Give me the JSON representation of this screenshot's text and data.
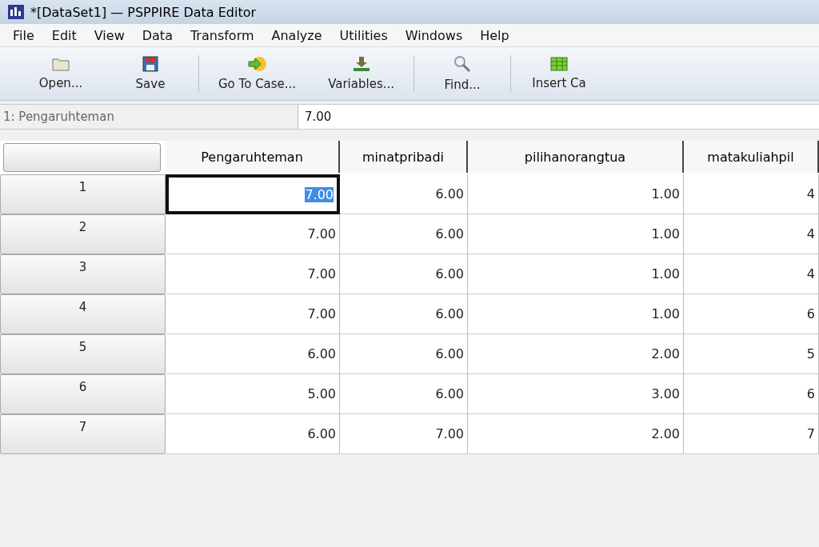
{
  "window": {
    "title": "*[DataSet1] — PSPPIRE Data Editor"
  },
  "menu": [
    "File",
    "Edit",
    "View",
    "Data",
    "Transform",
    "Analyze",
    "Utilities",
    "Windows",
    "Help"
  ],
  "toolbar": [
    {
      "kind": "open",
      "label": "Open..."
    },
    {
      "kind": "save",
      "label": "Save"
    },
    {
      "kind": "sep"
    },
    {
      "kind": "goto",
      "label": "Go To Case..."
    },
    {
      "kind": "variables",
      "label": "Variables..."
    },
    {
      "kind": "sep"
    },
    {
      "kind": "find",
      "label": "Find..."
    },
    {
      "kind": "sep"
    },
    {
      "kind": "insert",
      "label": "Insert Ca"
    }
  ],
  "cell_ref": {
    "name": "1: Pengaruhteman",
    "value": "7.00"
  },
  "table": {
    "columns": [
      "Pengaruhteman",
      "minatpribadi",
      "pilihanorangtua",
      "matakuliahpil"
    ],
    "rows": [
      {
        "label": "1",
        "cells": [
          "7.00",
          "6.00",
          "1.00",
          "4"
        ],
        "selected": true
      },
      {
        "label": "2",
        "cells": [
          "7.00",
          "6.00",
          "1.00",
          "4"
        ],
        "selected": false
      },
      {
        "label": "3",
        "cells": [
          "7.00",
          "6.00",
          "1.00",
          "4"
        ],
        "selected": false
      },
      {
        "label": "4",
        "cells": [
          "7.00",
          "6.00",
          "1.00",
          "6"
        ],
        "selected": false
      },
      {
        "label": "5",
        "cells": [
          "6.00",
          "6.00",
          "2.00",
          "5"
        ],
        "selected": false
      },
      {
        "label": "6",
        "cells": [
          "5.00",
          "6.00",
          "3.00",
          "6"
        ],
        "selected": false
      },
      {
        "label": "7",
        "cells": [
          "6.00",
          "7.00",
          "2.00",
          "7"
        ],
        "selected": false
      }
    ]
  }
}
